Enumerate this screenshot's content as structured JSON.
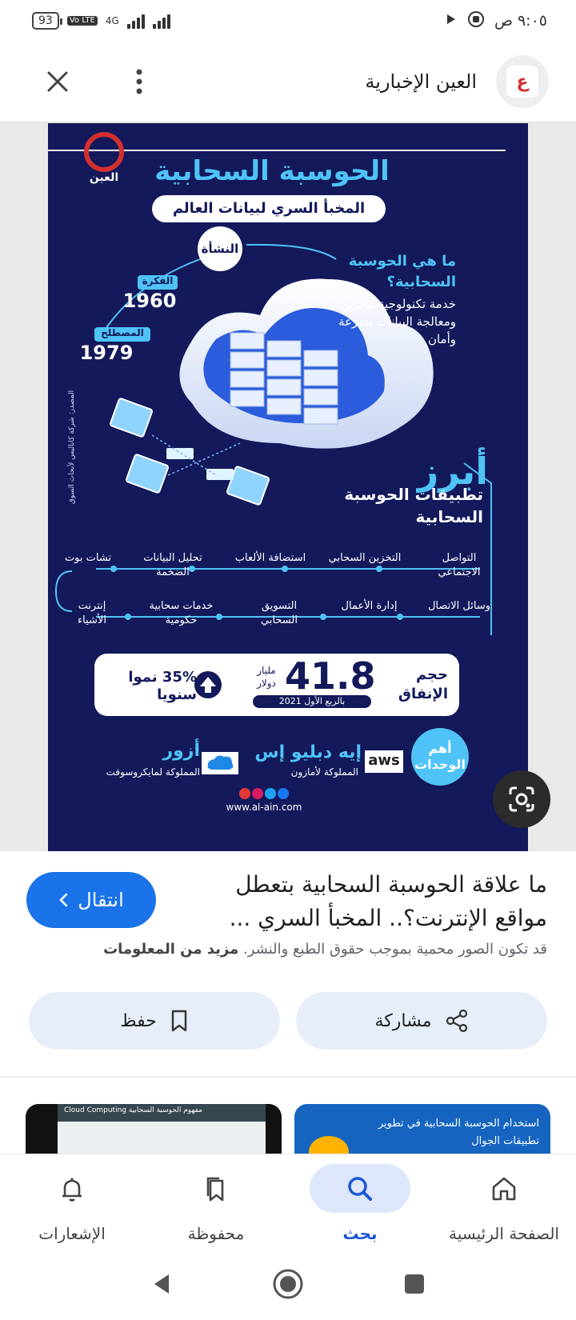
{
  "status_bar": {
    "battery": "93",
    "network": "4G",
    "volte": "Vo LTE",
    "time": "٩:٠٥ ص"
  },
  "header": {
    "source_name": "العين الإخبارية",
    "logo_letter": "ع"
  },
  "infographic": {
    "logo_text": "العين",
    "title": "الحوسبة السحابية",
    "subtitle": "المخبأ السري لبيانات العالم",
    "origin_label": "النشأة",
    "idea_label": "الفكرة",
    "idea_year": "1960",
    "term_label": "المصطلح",
    "term_year": "1979",
    "question": "ما هي الحوسبة السحابية؟",
    "answer": "خدمة تكنولوجية لتخزين ومعالجة البيانات بسرعة وأمان",
    "source_note": "المصدر: شركة كاناليس لأبحاث السوق",
    "apps_title_big": "أبرز",
    "apps_title_small": "تطبيقات الحوسبة السحابية",
    "apps_row1": [
      "التواصل الاجتماعي",
      "التخزين السحابي",
      "استضافة الألعاب",
      "تحليل البيانات الضخمة",
      "تشات بوت"
    ],
    "apps_row2": [
      "وسائل الاتصال",
      "إدارة الأعمال",
      "التسويق السحابي",
      "خدمات سحابية حكومية",
      "إنترنت الأشياء"
    ],
    "spend_label": "حجم الإنفاق",
    "spend_value": "41.8",
    "spend_unit": "مليار دولار",
    "spend_period": "بالربع الأول 2021",
    "growth": "35% نموا سنويا",
    "units_label": "أهم الوحدات",
    "aws_name": "إيه دبليو إس",
    "aws_owner": "المملوكة لأمازون",
    "aws_logo": "aws",
    "azure_name": "أزور",
    "azure_owner": "المملوكة لمايكروسوفت",
    "website": "www.al-ain.com"
  },
  "result": {
    "title": "ما علاقة الحوسبة السحابية بتعطل مواقع الإنترنت؟.. المخبأ السري ...",
    "visit_label": "انتقال",
    "copyright_text": "قد تكون الصور محمية بموجب حقوق الطبع والنشر.",
    "more_info": "مزيد من المعلومات"
  },
  "actions": {
    "share_label": "مشاركة",
    "save_label": "حفظ"
  },
  "related": {
    "thumb1_text": "استخدام الحوسبة السحابية في تطوير تطبيقات الجوال",
    "thumb2_text": "Cloud Computing مفهوم الحوسبة السحابية"
  },
  "bottom_nav": {
    "items": [
      {
        "label": "الصفحة الرئيسية",
        "icon": "home-icon",
        "active": false
      },
      {
        "label": "بحث",
        "icon": "search-icon",
        "active": true
      },
      {
        "label": "محفوظة",
        "icon": "bookmarks-icon",
        "active": false
      },
      {
        "label": "الإشعارات",
        "icon": "bell-icon",
        "active": false
      }
    ]
  },
  "colors": {
    "accent": "#1a73e8",
    "infographic_bg": "#13195a",
    "cyan": "#4fc3f7",
    "brand_red": "#d32f2f"
  }
}
